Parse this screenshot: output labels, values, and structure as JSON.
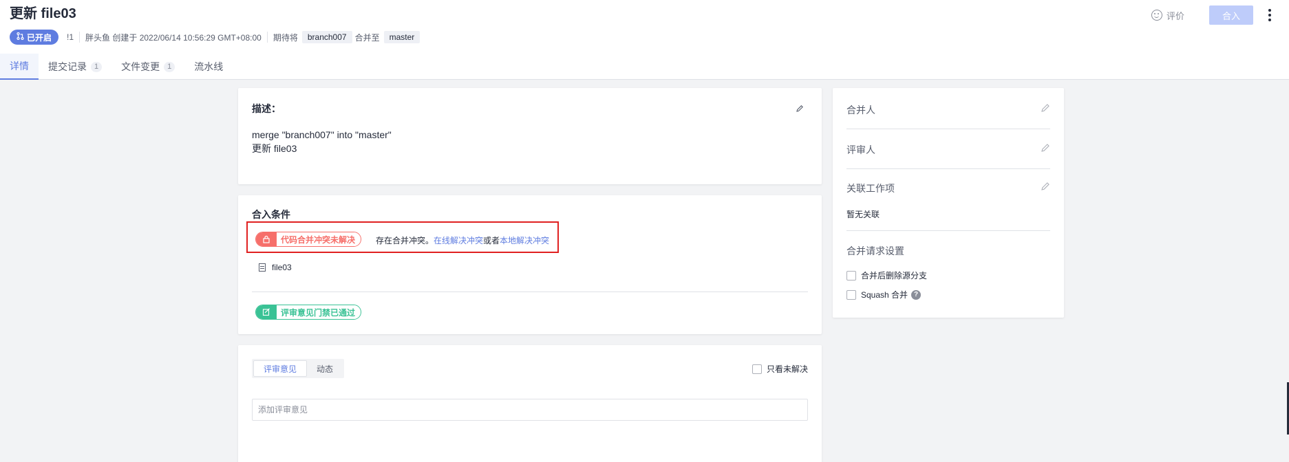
{
  "header": {
    "title": "更新 file03",
    "status_badge": "已开启",
    "mr_number": "!1",
    "author_created": "胖头鱼 创建于 2022/06/14 10:56:29 GMT+08:00",
    "expect_label": "期待将",
    "source_branch": "branch007",
    "merge_into_label": "合并至",
    "target_branch": "master",
    "rate_label": "评价",
    "merge_button": "合入"
  },
  "tabs": [
    {
      "label": "详情",
      "count": null
    },
    {
      "label": "提交记录",
      "count": "1"
    },
    {
      "label": "文件变更",
      "count": "1"
    },
    {
      "label": "流水线",
      "count": null
    }
  ],
  "description": {
    "label": "描述：",
    "line1": "merge \"branch007\" into \"master\"",
    "line2": "更新 file03"
  },
  "conditions": {
    "label": "合入条件",
    "conflict_badge": "代码合并冲突未解决",
    "conflict_prefix": "存在合并冲突。",
    "resolve_online": "在线解决冲突",
    "or_text": "或者",
    "resolve_local": "本地解决冲突",
    "file_name": "file03",
    "review_badge": "评审意见门禁已通过"
  },
  "review": {
    "tabs": [
      "评审意见",
      "动态"
    ],
    "filter_label": "只看未解决",
    "input_placeholder": "添加评审意见"
  },
  "sidebar": {
    "merger_label": "合并人",
    "reviewer_label": "评审人",
    "work_item_label": "关联工作项",
    "work_item_value": "暂无关联",
    "settings_label": "合并请求设置",
    "option_delete_source": "合并后删除源分支",
    "option_squash": "Squash 合并"
  },
  "colors": {
    "accent": "#5e7ce0",
    "danger": "#f66f6a",
    "success": "#3ac295",
    "highlight_border": "#e02020"
  }
}
